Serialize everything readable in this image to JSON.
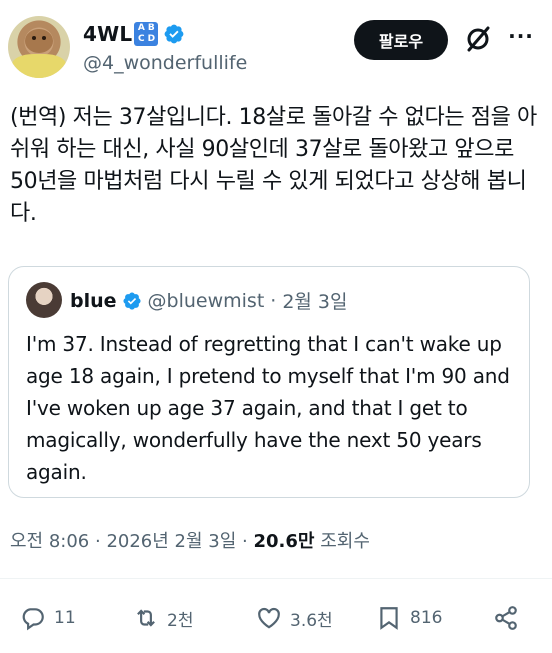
{
  "author": {
    "display_name": "4WL",
    "badge_letters": [
      "A",
      "B",
      "C",
      "D"
    ],
    "handle": "@4_wonderfullife",
    "verified_color": "#1d9bf0"
  },
  "header_actions": {
    "follow_label": "팔로우",
    "grok_icon": "grok-icon",
    "more_label": "···"
  },
  "tweet": {
    "text": "(번역) 저는 37살입니다. 18살로 돌아갈 수 없다는 점을 아쉬워 하는 대신, 사실 90살인데 37살로 돌아왔고 앞으로 50년을 마법처럼 다시 누릴 수 있게 되었다고 상상해 봅니다."
  },
  "quote": {
    "name": "blue",
    "handle": "@bluewmist",
    "date": "2월 3일",
    "text": "I'm 37. Instead of regretting that I can't wake up age 18 again, I pretend to myself that I'm 90 and I've woken up age 37 again, and that I get to magically, wonderfully have the next 50 years again."
  },
  "meta": {
    "time": "오전 8:06",
    "date": "2026년 2월 3일",
    "views_count": "20.6만",
    "views_label": "조회수"
  },
  "actions": {
    "replies": "11",
    "retweets": "2천",
    "likes": "3.6천",
    "bookmarks": "816"
  }
}
